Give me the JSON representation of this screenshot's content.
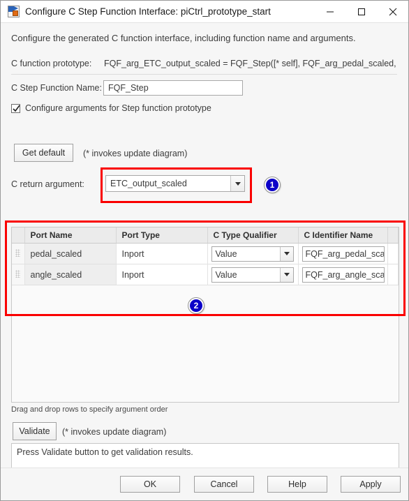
{
  "window": {
    "title": "Configure C Step Function Interface: piCtrl_prototype_start",
    "icon": "simulink-app-icon",
    "controls": {
      "minimize": "minimize-icon",
      "maximize": "maximize-icon",
      "close": "close-icon"
    }
  },
  "intro": "Configure the generated C function interface, including function name and arguments.",
  "prototype": {
    "label": "C function prototype:",
    "value": "FQF_arg_ETC_output_scaled = FQF_Step([* self], FQF_arg_pedal_scaled, …"
  },
  "step_function": {
    "label": "C Step Function Name:",
    "value": "FQF_Step",
    "placeholder": ""
  },
  "configure_checkbox": {
    "label": "Configure arguments for Step function prototype",
    "checked": true
  },
  "get_default": {
    "label": "Get default",
    "note": "(* invokes update diagram)"
  },
  "return_argument": {
    "label": "C return argument:",
    "value": "ETC_output_scaled",
    "options": [
      "ETC_output_scaled"
    ]
  },
  "table": {
    "headers": [
      "",
      "Port Name",
      "Port Type",
      "C Type Qualifier",
      "C Identifier Name",
      ""
    ],
    "rows": [
      {
        "grip": "drag-handle-icon",
        "port_name": "pedal_scaled",
        "port_type": "Inport",
        "type_qualifier": "Value",
        "identifier": "FQF_arg_pedal_scal"
      },
      {
        "grip": "drag-handle-icon",
        "port_name": "angle_scaled",
        "port_type": "Inport",
        "type_qualifier": "Value",
        "identifier": "FQF_arg_angle_scal"
      }
    ],
    "drag_note": "Drag and drop rows to specify argument order"
  },
  "validate": {
    "label": "Validate",
    "note": "(* invokes update diagram)",
    "results": "Press Validate button to get validation results."
  },
  "footer": {
    "ok": "OK",
    "cancel": "Cancel",
    "help": "Help",
    "apply": "Apply"
  },
  "annotations": {
    "badge_1": "1",
    "badge_2": "2",
    "color": "#fa0000",
    "badge_color": "#0b00c8"
  }
}
